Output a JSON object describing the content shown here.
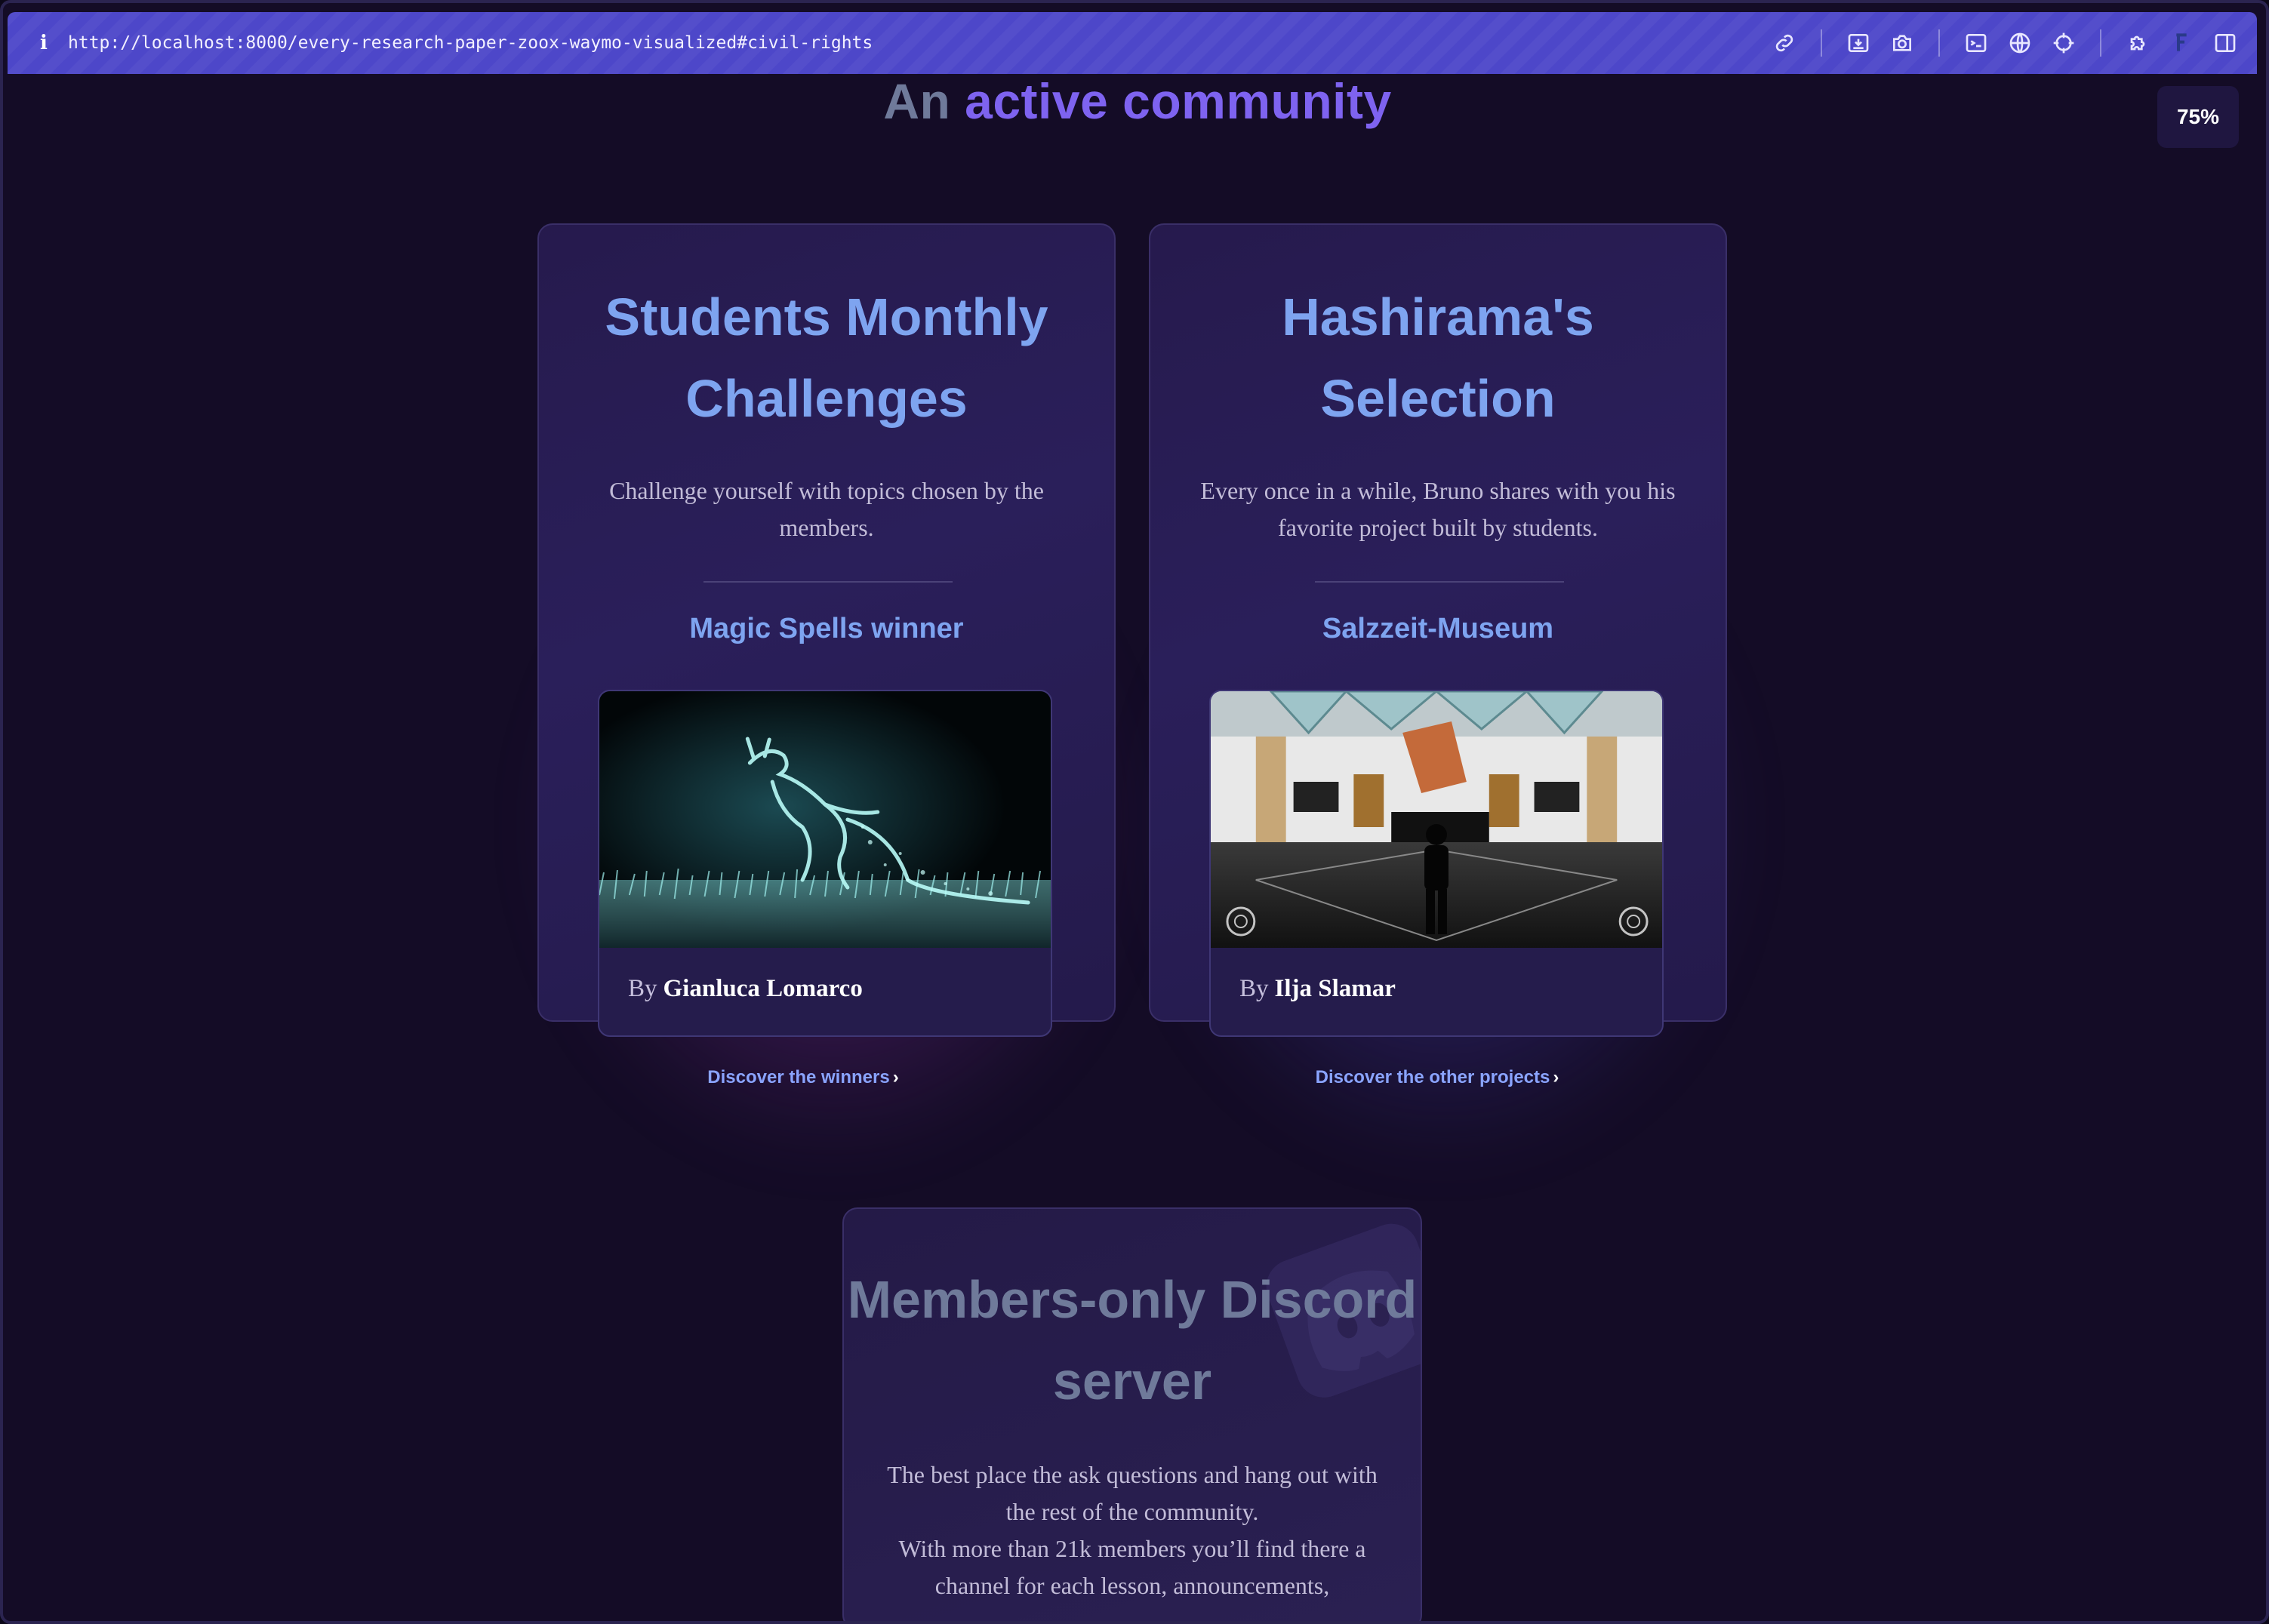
{
  "browser": {
    "url": "http://localhost:8000/every-research-paper-zoox-waymo-visualized#civil-rights",
    "info_icon": "i",
    "zoom": "75%",
    "toolbar_icons": [
      "link-icon",
      "save-page-icon",
      "camera-icon",
      "terminal-icon",
      "globe-icon",
      "crosshair-icon",
      "extensions-icon",
      "brand-icon",
      "sidebar-icon"
    ]
  },
  "section": {
    "heading_plain": "An",
    "heading_accent": "active community"
  },
  "cards": [
    {
      "title": "Students Monthly Challenges",
      "description": "Challenge yourself with topics chosen by the members.",
      "subtitle": "Magic Spells winner",
      "by_label": "By",
      "author": "Gianluca Lomarco",
      "link": "Discover the winners"
    },
    {
      "title": "Hashirama's Selection",
      "description": "Every once in a while, Bruno shares with you his favorite project built by students.",
      "subtitle": "Salzzeit-Museum",
      "by_label": "By",
      "author": "Ilja Slamar",
      "link": "Discover the other projects"
    }
  ],
  "discord": {
    "title": "Members-only Discord server",
    "description_1": "The best place the ask questions and hang out with the rest of the community.",
    "description_2": "With more than 21k members you’ll find there a channel for each lesson, announcements,"
  },
  "colors": {
    "accent_blue": "#7ea4f0",
    "accent_purple": "#7e63f0",
    "background": "#140c26",
    "urlbar": "#4d47c9"
  }
}
